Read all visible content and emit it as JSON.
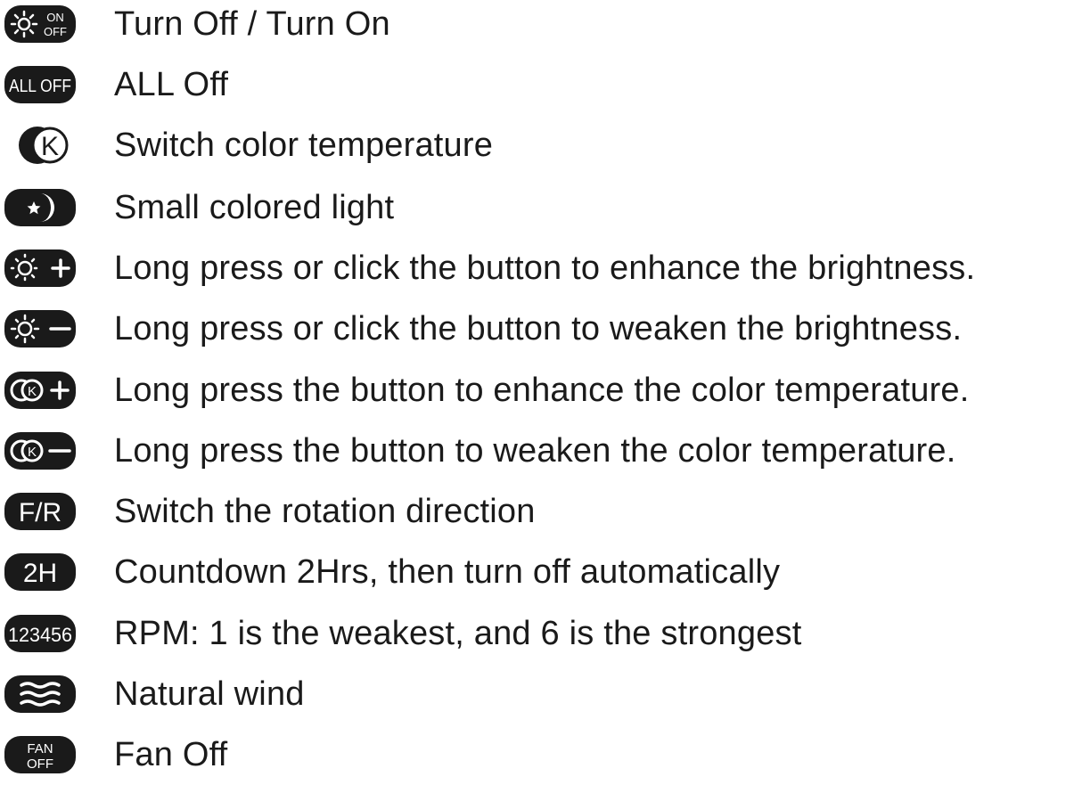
{
  "legend": {
    "items": [
      {
        "icon": "on-off-icon",
        "badge": "ON OFF",
        "label": "Turn Off / Turn On"
      },
      {
        "icon": "all-off-icon",
        "badge": "ALL OFF",
        "label": "ALL Off"
      },
      {
        "icon": "color-temperature-k-icon",
        "badge": "K",
        "label": "Switch color temperature"
      },
      {
        "icon": "night-light-moon-icon",
        "badge": "",
        "label": "Small colored light"
      },
      {
        "icon": "brightness-plus-icon",
        "badge": "+",
        "label": "Long press or click the button to enhance the brightness."
      },
      {
        "icon": "brightness-minus-icon",
        "badge": "−",
        "label": "Long press or click the button to weaken the brightness."
      },
      {
        "icon": "color-temp-plus-icon",
        "badge": "+",
        "label": "Long press the button to enhance the color temperature."
      },
      {
        "icon": "color-temp-minus-icon",
        "badge": "−",
        "label": "Long press the button to weaken the color temperature."
      },
      {
        "icon": "fan-reverse-icon",
        "badge": "F/R",
        "label": "Switch the rotation direction"
      },
      {
        "icon": "timer-2h-icon",
        "badge": "2H",
        "label": "Countdown 2Hrs, then turn off automatically"
      },
      {
        "icon": "speed-123456-icon",
        "badge": "123456",
        "label": "RPM: 1 is the weakest, and 6 is the strongest"
      },
      {
        "icon": "natural-wind-icon",
        "badge": "",
        "label": "Natural wind"
      },
      {
        "icon": "fan-off-icon",
        "badge": "FAN OFF",
        "label": "Fan Off"
      }
    ]
  }
}
